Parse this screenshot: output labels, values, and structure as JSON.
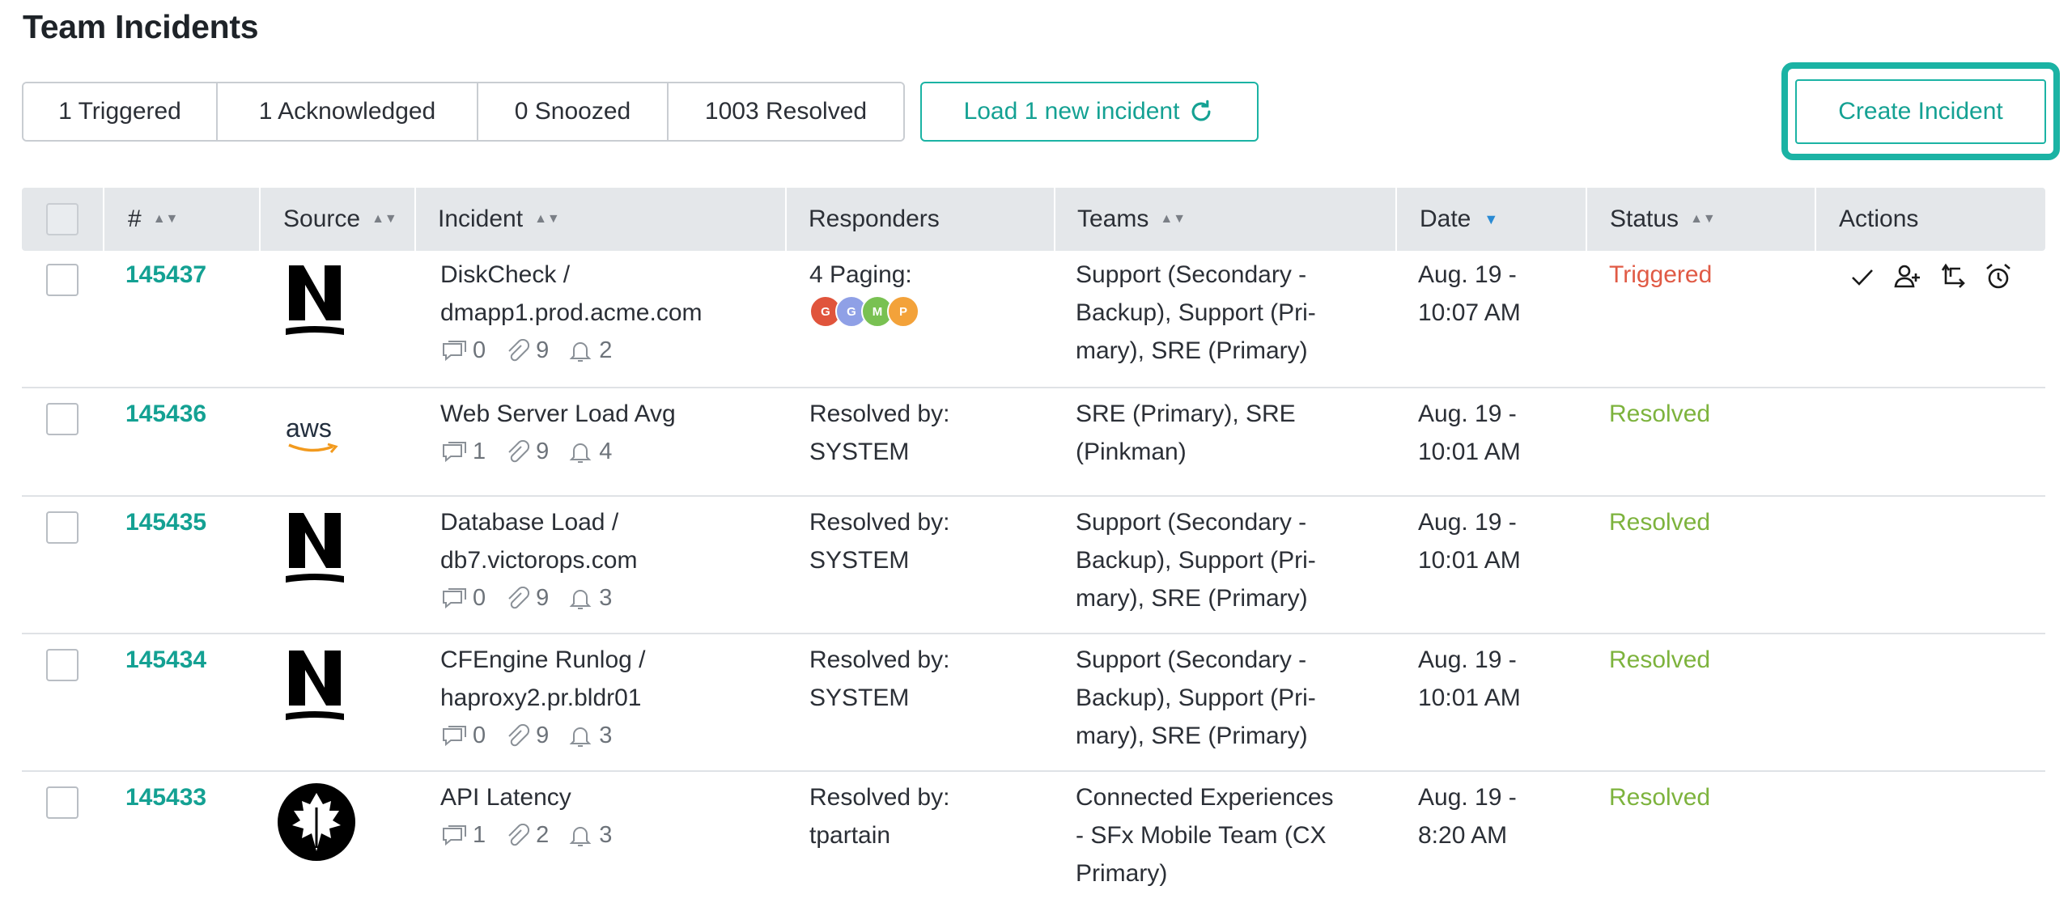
{
  "page": {
    "title": "Team Incidents"
  },
  "filters": [
    {
      "label": "1 Triggered"
    },
    {
      "label": "1 Acknowledged"
    },
    {
      "label": "0 Snoozed"
    },
    {
      "label": "1003 Resolved"
    }
  ],
  "load_button": {
    "label": "Load 1 new incident"
  },
  "create_button": {
    "label": "Create Incident"
  },
  "columns": {
    "number": "#",
    "source": "Source",
    "incident": "Incident",
    "responders": "Responders",
    "teams": "Teams",
    "date": "Date",
    "status": "Status",
    "actions": "Actions"
  },
  "rows": [
    {
      "number": "145437",
      "source_icon": "n-logo-icon",
      "incident_lines": [
        "DiskCheck /",
        "dmapp1.prod.acme.com"
      ],
      "comments": "0",
      "attachments": "9",
      "alerts": "2",
      "responders_label": "4 Paging:",
      "responders_avatars": [
        {
          "initial": "G",
          "color": "#e0543c"
        },
        {
          "initial": "G",
          "color": "#8fa0e6"
        },
        {
          "initial": "M",
          "color": "#79c152"
        },
        {
          "initial": "P",
          "color": "#f3a23a"
        }
      ],
      "teams_lines": [
        "Support (Secondary -",
        "Backup), Support (Pri-",
        "mary), SRE (Primary)"
      ],
      "date_lines": [
        "Aug. 19 -",
        "10:07 AM"
      ],
      "status": "Triggered",
      "status_color": "#e05a45"
    },
    {
      "number": "145436",
      "source_icon": "aws-logo-icon",
      "source_text": "aws",
      "incident_lines": [
        "Web Server Load Avg"
      ],
      "comments": "1",
      "attachments": "9",
      "alerts": "4",
      "responders_lines": [
        "Resolved by:",
        "SYSTEM"
      ],
      "teams_lines": [
        "SRE (Primary), SRE",
        "(Pinkman)"
      ],
      "date_lines": [
        "Aug. 19 -",
        "10:01 AM"
      ],
      "status": "Resolved",
      "status_color": "#7db33d"
    },
    {
      "number": "145435",
      "source_icon": "n-logo-icon",
      "incident_lines": [
        "Database Load /",
        "db7.victorops.com"
      ],
      "comments": "0",
      "attachments": "9",
      "alerts": "3",
      "responders_lines": [
        "Resolved by:",
        "SYSTEM"
      ],
      "teams_lines": [
        "Support (Secondary -",
        "Backup), Support (Pri-",
        "mary), SRE (Primary)"
      ],
      "date_lines": [
        "Aug. 19 -",
        "10:01 AM"
      ],
      "status": "Resolved",
      "status_color": "#7db33d"
    },
    {
      "number": "145434",
      "source_icon": "n-logo-icon",
      "incident_lines": [
        "CFEngine Runlog /",
        "haproxy2.pr.bldr01"
      ],
      "comments": "0",
      "attachments": "9",
      "alerts": "3",
      "responders_lines": [
        "Resolved by:",
        "SYSTEM"
      ],
      "teams_lines": [
        "Support (Secondary -",
        "Backup), Support (Pri-",
        "mary), SRE (Primary)"
      ],
      "date_lines": [
        "Aug. 19 -",
        "10:01 AM"
      ],
      "status": "Resolved",
      "status_color": "#7db33d"
    },
    {
      "number": "145433",
      "source_icon": "leaf-logo-icon",
      "incident_lines": [
        "API Latency"
      ],
      "comments": "1",
      "attachments": "2",
      "alerts": "3",
      "responders_lines": [
        "Resolved by:",
        "tpartain"
      ],
      "teams_lines": [
        "Connected Experiences",
        "- SFx Mobile Team (CX",
        "Primary)"
      ],
      "date_lines": [
        "Aug. 19 -",
        "8:20 AM"
      ],
      "status": "Resolved",
      "status_color": "#7db33d"
    }
  ],
  "action_icons": [
    "acknowledge-check-icon",
    "add-responder-icon",
    "reroute-icon",
    "snooze-alarm-icon"
  ]
}
